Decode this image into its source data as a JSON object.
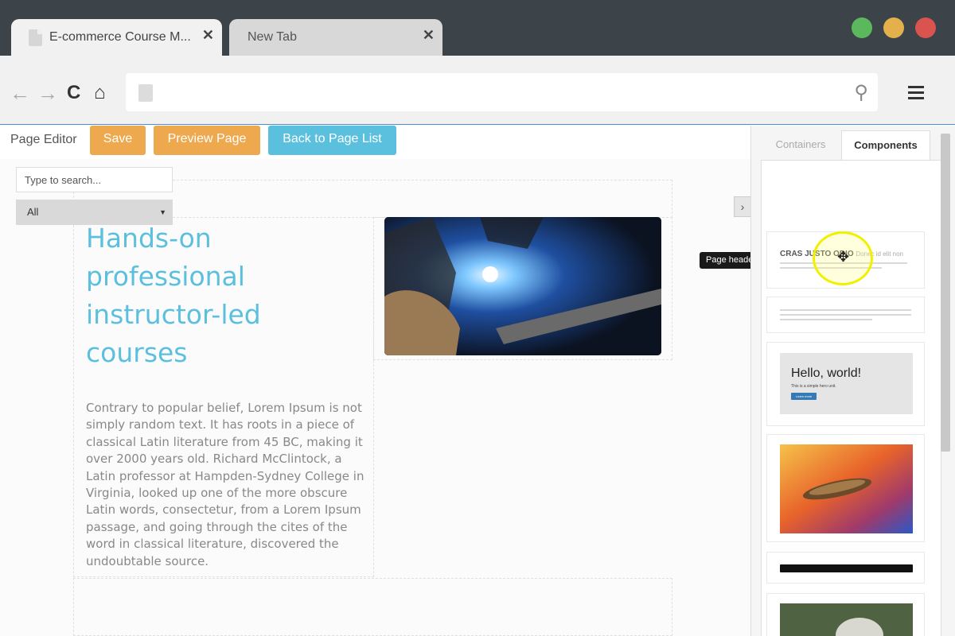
{
  "browser": {
    "tabs": [
      {
        "title": "E-commerce Course M...",
        "close": "✕"
      },
      {
        "title": "New Tab",
        "close": "✕"
      }
    ],
    "nav": {
      "back": "←",
      "forward": "→",
      "reload": "C",
      "home": "⌂",
      "search_icon": "⚲"
    },
    "window_controls": {
      "green": "#5cb85c",
      "yellow": "#e3b04b",
      "red": "#d9534f"
    }
  },
  "editor": {
    "title": "Page Editor",
    "save_label": "Save",
    "preview_label": "Preview Page",
    "back_label": "Back to Page List",
    "collapse_icon": "›"
  },
  "content": {
    "hero_title": "Hands-on professional instructor-led courses",
    "hero_body": "Contrary to popular belief, Lorem Ipsum is not simply random text. It has roots in a piece of classical Latin literature from 45 BC, making it over 2000 years old. Richard McClintock, a Latin professor at Hampden-Sydney College in Virginia, looked up one of the more obscure Latin words, consectetur, from a Lorem Ipsum passage, and going through the cites of the word in classical literature, discovered the undoubtable source."
  },
  "sidebar": {
    "tabs": {
      "containers": "Containers",
      "components": "Components"
    },
    "search_placeholder": "Type to search...",
    "filter_value": "All",
    "filter_caret": "▼",
    "tooltip": "Page header",
    "components": {
      "page_header": {
        "heading": "CRAS JUSTO ODIO",
        "subheading": "Donec id elit non"
      },
      "jumbotron": {
        "heading": "Hello, world!",
        "text": "This is a simple hero unit.",
        "button": "Learn more"
      }
    }
  },
  "colors": {
    "accent_orange": "#eea94e",
    "accent_blue": "#5bc0de",
    "title_blue": "#5bc0de"
  }
}
